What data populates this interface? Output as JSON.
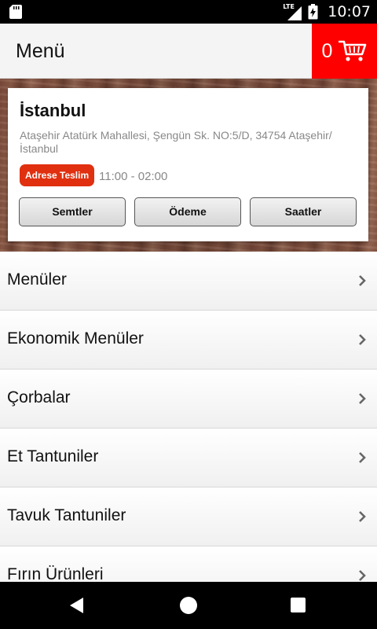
{
  "status_bar": {
    "network": "LTE",
    "time": "10:07",
    "icons": [
      "sd-card-icon",
      "signal-icon",
      "battery-icon"
    ]
  },
  "header": {
    "title": "Menü",
    "cart_count": "0",
    "cart_icon": "shopping-cart-icon",
    "cart_color": "#ff0000"
  },
  "restaurant": {
    "city": "İstanbul",
    "address": "Ataşehir Atatürk Mahallesi, Şengün Sk. NO:5/D, 34754 Ataşehir/İstanbul",
    "delivery_badge": "Adrese Teslim",
    "badge_color": "#e03010",
    "hours": "11:00 - 02:00",
    "buttons": {
      "districts": "Semtler",
      "payment": "Ödeme",
      "hours": "Saatler"
    }
  },
  "menu": {
    "items": [
      {
        "label": "Menüler"
      },
      {
        "label": "Ekonomik Menüler"
      },
      {
        "label": "Çorbalar"
      },
      {
        "label": "Et Tantuniler"
      },
      {
        "label": "Tavuk Tantuniler"
      },
      {
        "label": "Fırın Ürünleri"
      }
    ]
  },
  "nav_bar": {
    "icons": [
      "back-icon",
      "home-icon",
      "recent-apps-icon"
    ]
  }
}
